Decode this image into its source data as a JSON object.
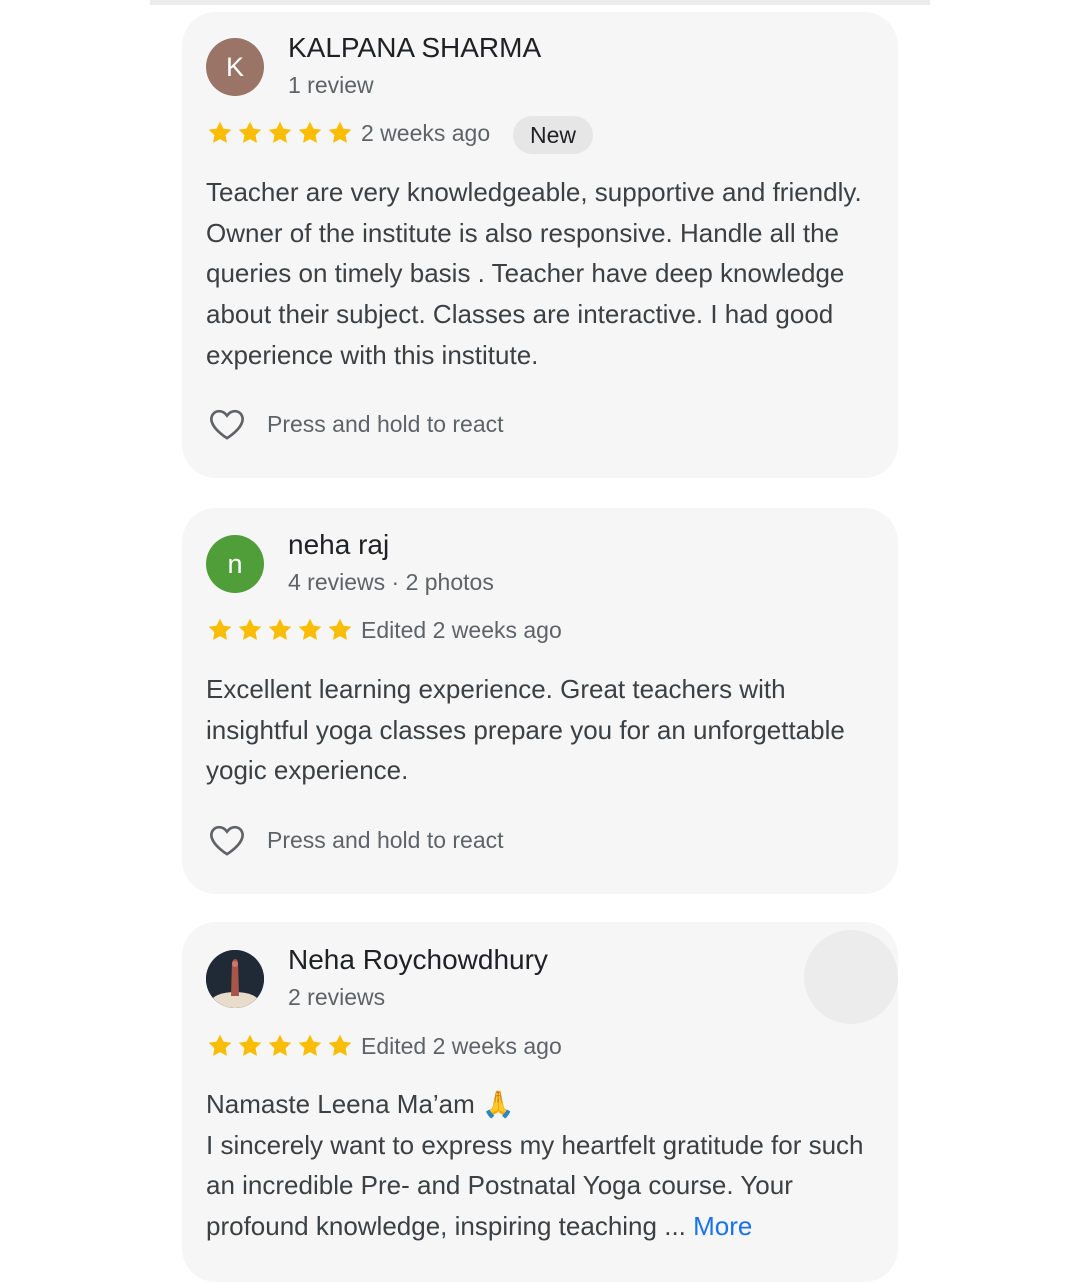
{
  "reviews": [
    {
      "avatar_letter": "K",
      "avatar_color": "#9a7567",
      "name": "KALPANA SHARMA",
      "meta": "1 review",
      "rating": 5,
      "time": "2 weeks ago",
      "badge": "New",
      "text": "Teacher are very knowledgeable, supportive and friendly. Owner of the institute is also responsive. Handle all the queries on timely basis . Teacher have deep knowledge about their subject. Classes are interactive. I had good experience with this institute.",
      "react_label": "Press and hold to react"
    },
    {
      "avatar_letter": "n",
      "avatar_color": "#4f9e3a",
      "name": "neha raj",
      "meta": "4 reviews · 2 photos",
      "rating": 5,
      "time": "Edited 2 weeks ago",
      "text": "Excellent learning experience. Great teachers with insightful yoga classes prepare you for an unforgettable yogic experience.",
      "react_label": "Press and hold to react"
    },
    {
      "avatar_icon": "profile-photo",
      "name": "Neha Roychowdhury",
      "meta": "2 reviews",
      "rating": 5,
      "time": "Edited 2 weeks ago",
      "text_line1": "Namaste Leena Ma’am 🙏",
      "text_rest": "I sincerely want to express my heartfelt gratitude for such an incredible Pre- and Postnatal Yoga course. Your profound knowledge, inspiring teaching",
      "ellipsis": "...",
      "more_label": "More"
    }
  ],
  "colors": {
    "star": "#fbbc04",
    "link": "#1a73e8",
    "card_bg": "#f6f6f6"
  }
}
